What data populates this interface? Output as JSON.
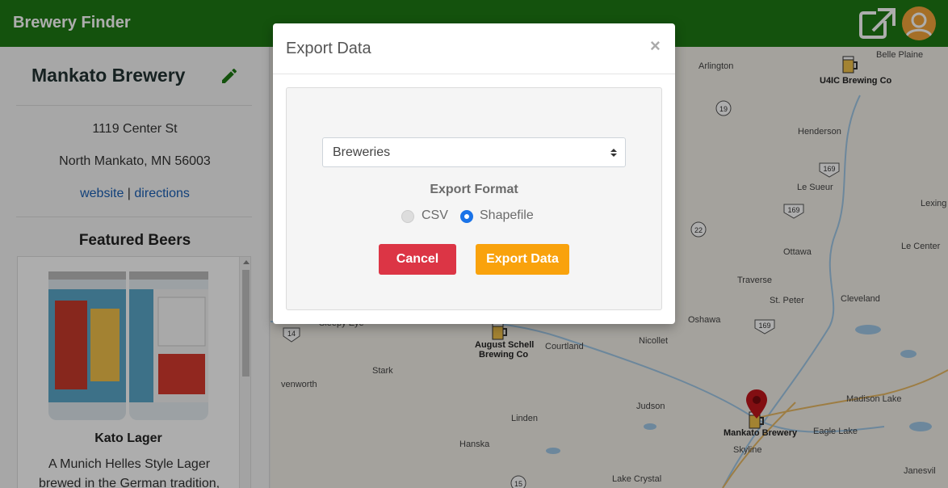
{
  "app": {
    "title": "Brewery Finder"
  },
  "sidebar": {
    "brewery_name": "Mankato Brewery",
    "address_line1": "1119 Center St",
    "address_line2": "North Mankato, MN 56003",
    "link_website": "website",
    "link_separator": "|",
    "link_directions": "directions",
    "featured_title": "Featured Beers",
    "beer": {
      "name": "Kato Lager",
      "description": "A Munich Helles Style Lager brewed in the German tradition,"
    }
  },
  "map": {
    "labels": [
      {
        "text": "Arlington",
        "bold": false
      },
      {
        "text": "Belle Plaine",
        "bold": false
      },
      {
        "text": "U4IC Brewing Co",
        "bold": true
      },
      {
        "text": "Henderson",
        "bold": false
      },
      {
        "text": "Le Sueur",
        "bold": false
      },
      {
        "text": "Lexing",
        "bold": false
      },
      {
        "text": "Le Center",
        "bold": false
      },
      {
        "text": "Ottawa",
        "bold": false
      },
      {
        "text": "Traverse",
        "bold": false
      },
      {
        "text": "St. Peter",
        "bold": false
      },
      {
        "text": "Cleveland",
        "bold": false
      },
      {
        "text": "Oshawa",
        "bold": false
      },
      {
        "text": "Sleepy Eye",
        "bold": false
      },
      {
        "text": "August Schell",
        "bold": true
      },
      {
        "text": "Brewing Co",
        "bold": true
      },
      {
        "text": "Courtland",
        "bold": false
      },
      {
        "text": "Nicollet",
        "bold": false
      },
      {
        "text": "Stark",
        "bold": false
      },
      {
        "text": "venworth",
        "bold": false
      },
      {
        "text": "Judson",
        "bold": false
      },
      {
        "text": "Madison Lake",
        "bold": false
      },
      {
        "text": "Mankato Brewery",
        "bold": true
      },
      {
        "text": "Eagle Lake",
        "bold": false
      },
      {
        "text": "Linden",
        "bold": false
      },
      {
        "text": "Skyline",
        "bold": false
      },
      {
        "text": "Hanska",
        "bold": false
      },
      {
        "text": "Janesvil",
        "bold": false
      },
      {
        "text": "Lake Crystal",
        "bold": false
      }
    ],
    "shields": [
      "19",
      "169",
      "169",
      "22",
      "169",
      "14",
      "15"
    ]
  },
  "modal": {
    "title": "Export Data",
    "close": "×",
    "select_value": "Breweries",
    "format_title": "Export Format",
    "option_csv": "CSV",
    "option_shapefile": "Shapefile",
    "selected_format": "Shapefile",
    "cancel_label": "Cancel",
    "export_label": "Export Data"
  },
  "colors": {
    "header": "#1e7a14",
    "cancel": "#dc3545",
    "export": "#f9a20c",
    "radio_selected": "#1a73e8",
    "avatar": "#f3a43a"
  },
  "icons": [
    "edit-pencil-icon",
    "external-link-icon",
    "user-avatar-icon",
    "map-pin-icon",
    "beer-mug-icon",
    "select-caret-icon",
    "close-icon"
  ]
}
